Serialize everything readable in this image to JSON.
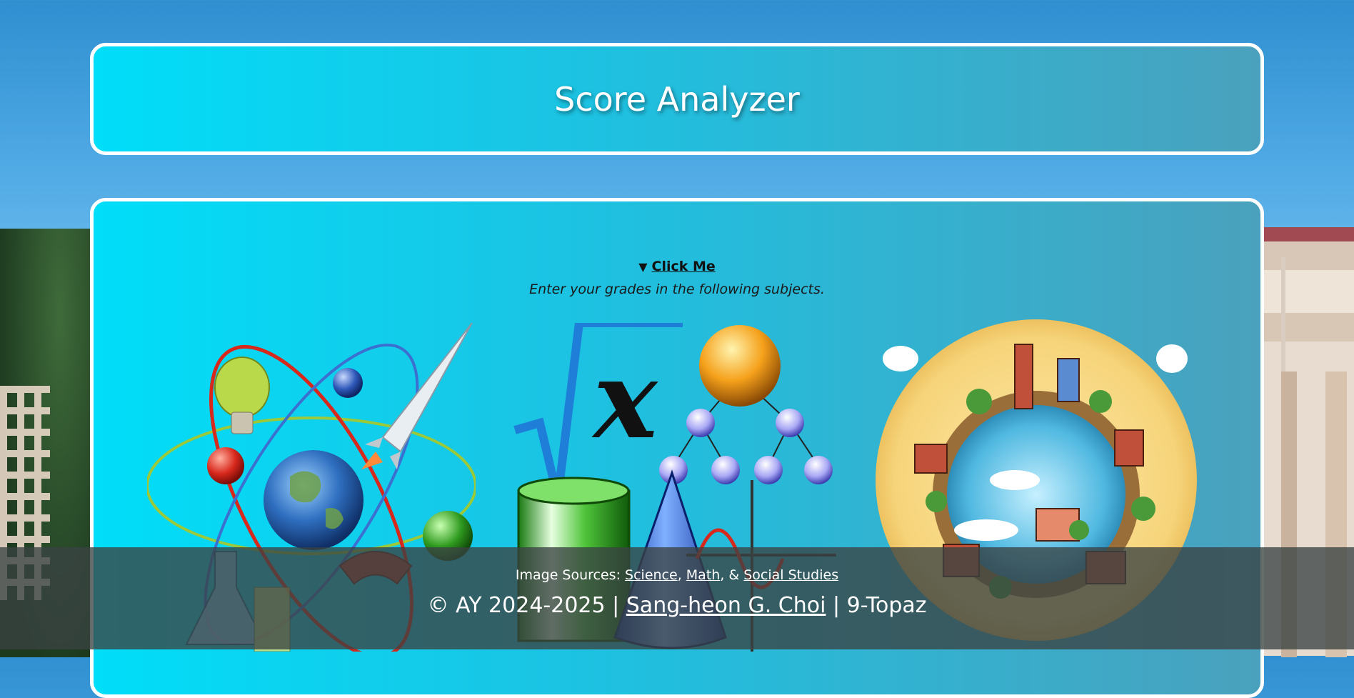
{
  "header": {
    "title": "Score Analyzer"
  },
  "main": {
    "toggle_symbol": "▼",
    "toggle_label": "Click Me",
    "instruction": "Enter your grades in the following subjects."
  },
  "images": {
    "science_icon": "science-collage",
    "math_icon": "math-collage",
    "social_icon": "social-studies-globe"
  },
  "footer": {
    "sources_prefix": "Image Sources: ",
    "science_link": "Science",
    "sep1": ", ",
    "math_link": "Math",
    "sep2": ", & ",
    "social_link": "Social Studies",
    "copyright": "© AY 2024-2025 | ",
    "author": "Sang-heon G. Choi",
    "class_sep": " | ",
    "class_name": "9-Topaz"
  },
  "colors": {
    "panel_gradient_start": "#00def9",
    "panel_gradient_end": "#4aa1bd",
    "border": "#ffffff",
    "footer_bg": "#3a4242"
  }
}
